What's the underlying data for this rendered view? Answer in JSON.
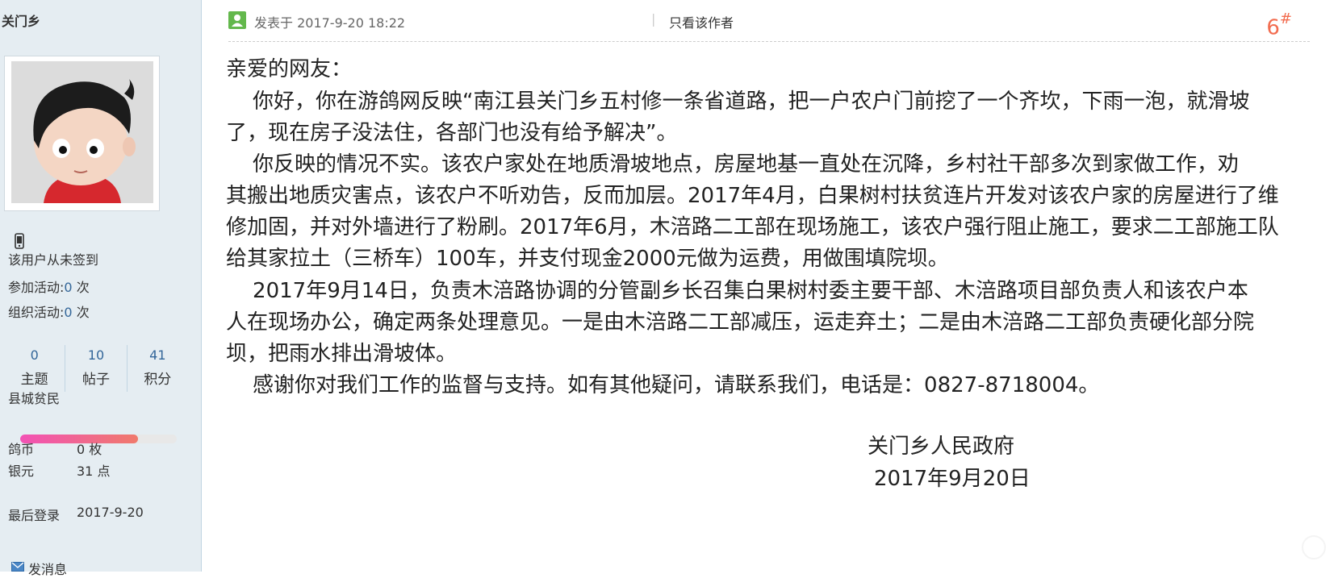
{
  "sidebar": {
    "username": "关门乡",
    "sign_status": "该用户从未签到",
    "activity_join_label": "参加活动:",
    "activity_join_count": "0",
    "activity_join_unit": "次",
    "activity_org_label": "组织活动:",
    "activity_org_count": "0",
    "activity_org_unit": "次",
    "stats": [
      {
        "value": "0",
        "label": "主题"
      },
      {
        "value": "10",
        "label": "帖子"
      },
      {
        "value": "41",
        "label": "积分"
      }
    ],
    "group": "县城贫民",
    "level_progress": 0.75,
    "coins_label": "鸽币",
    "coins_value": "0 枚",
    "silver_label": "银元",
    "silver_value": "31 点",
    "last_login_label": "最后登录",
    "last_login_value": "2017-9-20",
    "send_message": "发消息"
  },
  "post": {
    "posted_at": "发表于 2017-9-20 18:22",
    "separator": "|",
    "author_only": "只看该作者",
    "floor": "6",
    "floor_mark": "#",
    "lines": [
      "亲爱的网友：",
      "    你好，你在游鸽网反映“南江县关门乡五村修一条省道路，把一户农户门前挖了一个齐坎，下雨一泡，就滑坡",
      "了，现在房子没法住，各部门也没有给予解决”。",
      "    你反映的情况不实。该农户家处在地质滑坡地点，房屋地基一直处在沉降，乡村社干部多次到家做工作，劝",
      "其搬出地质灾害点，该农户不听劝告，反而加层。2017年4月，白果树村扶贫连片开发对该农户家的房屋进行了维",
      "修加固，并对外墙进行了粉刷。2017年6月，木涪路二工部在现场施工，该农户强行阻止施工，要求二工部施工队",
      "给其家拉土（三桥车）100车，并支付现金2000元做为运费，用做围填院坝。",
      "    2017年9月14日，负责木涪路协调的分管副乡长召集白果树村委主要干部、木涪路项目部负责人和该农户本",
      "人在现场办公，确定两条处理意见。一是由木涪路二工部减压，运走弃土；二是由木涪路二工部负责硬化部分院",
      "坝，把雨水排出滑坡体。",
      "    感谢你对我们工作的监督与支持。如有其他疑问，请联系我们，电话是：0827-8718004。"
    ],
    "signature_org": "关门乡人民政府",
    "signature_date": "2017年9月20日"
  },
  "colors": {
    "sidebar_bg": "#e5edf2",
    "floor_number": "#f26c4f",
    "link_blue": "#369"
  }
}
